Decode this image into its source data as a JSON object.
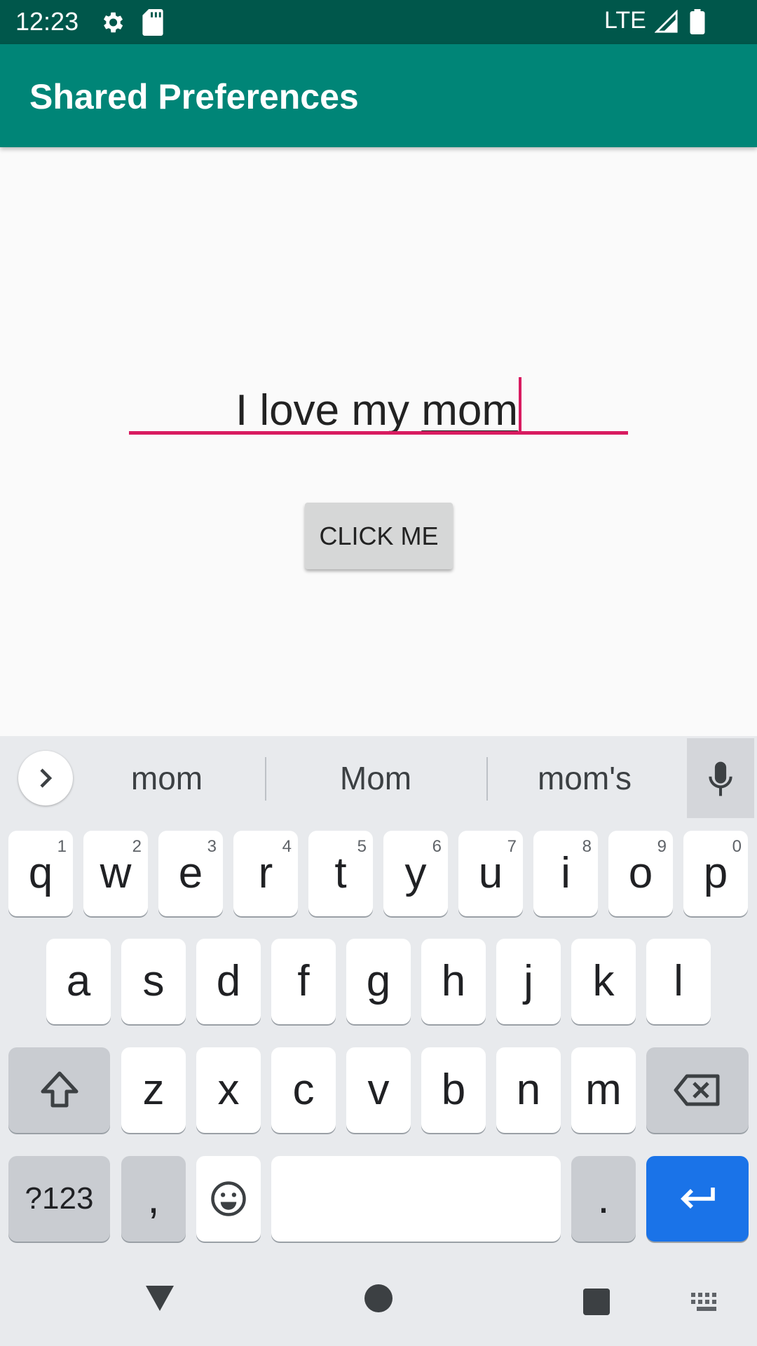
{
  "status_bar": {
    "time": "12:23",
    "network": "LTE",
    "icons": [
      "settings-icon",
      "sd-card-icon",
      "signal-icon",
      "battery-icon"
    ]
  },
  "app_bar": {
    "title": "Shared Preferences"
  },
  "main": {
    "edit_text": {
      "value_prefix": "I love my ",
      "value_composing": "mom"
    },
    "button_label": "CLICK ME"
  },
  "keyboard": {
    "suggestions": [
      "mom",
      "Mom",
      "mom's"
    ],
    "row1": [
      {
        "key": "q",
        "hint": "1"
      },
      {
        "key": "w",
        "hint": "2"
      },
      {
        "key": "e",
        "hint": "3"
      },
      {
        "key": "r",
        "hint": "4"
      },
      {
        "key": "t",
        "hint": "5"
      },
      {
        "key": "y",
        "hint": "6"
      },
      {
        "key": "u",
        "hint": "7"
      },
      {
        "key": "i",
        "hint": "8"
      },
      {
        "key": "o",
        "hint": "9"
      },
      {
        "key": "p",
        "hint": "0"
      }
    ],
    "row2": [
      "a",
      "s",
      "d",
      "f",
      "g",
      "h",
      "j",
      "k",
      "l"
    ],
    "row3": [
      "z",
      "x",
      "c",
      "v",
      "b",
      "n",
      "m"
    ],
    "symbols_label": "?123",
    "comma": ",",
    "period": "."
  },
  "colors": {
    "status_bar": "#00574b",
    "app_bar": "#008577",
    "accent": "#d81b60",
    "enter_key": "#1a73e8"
  }
}
